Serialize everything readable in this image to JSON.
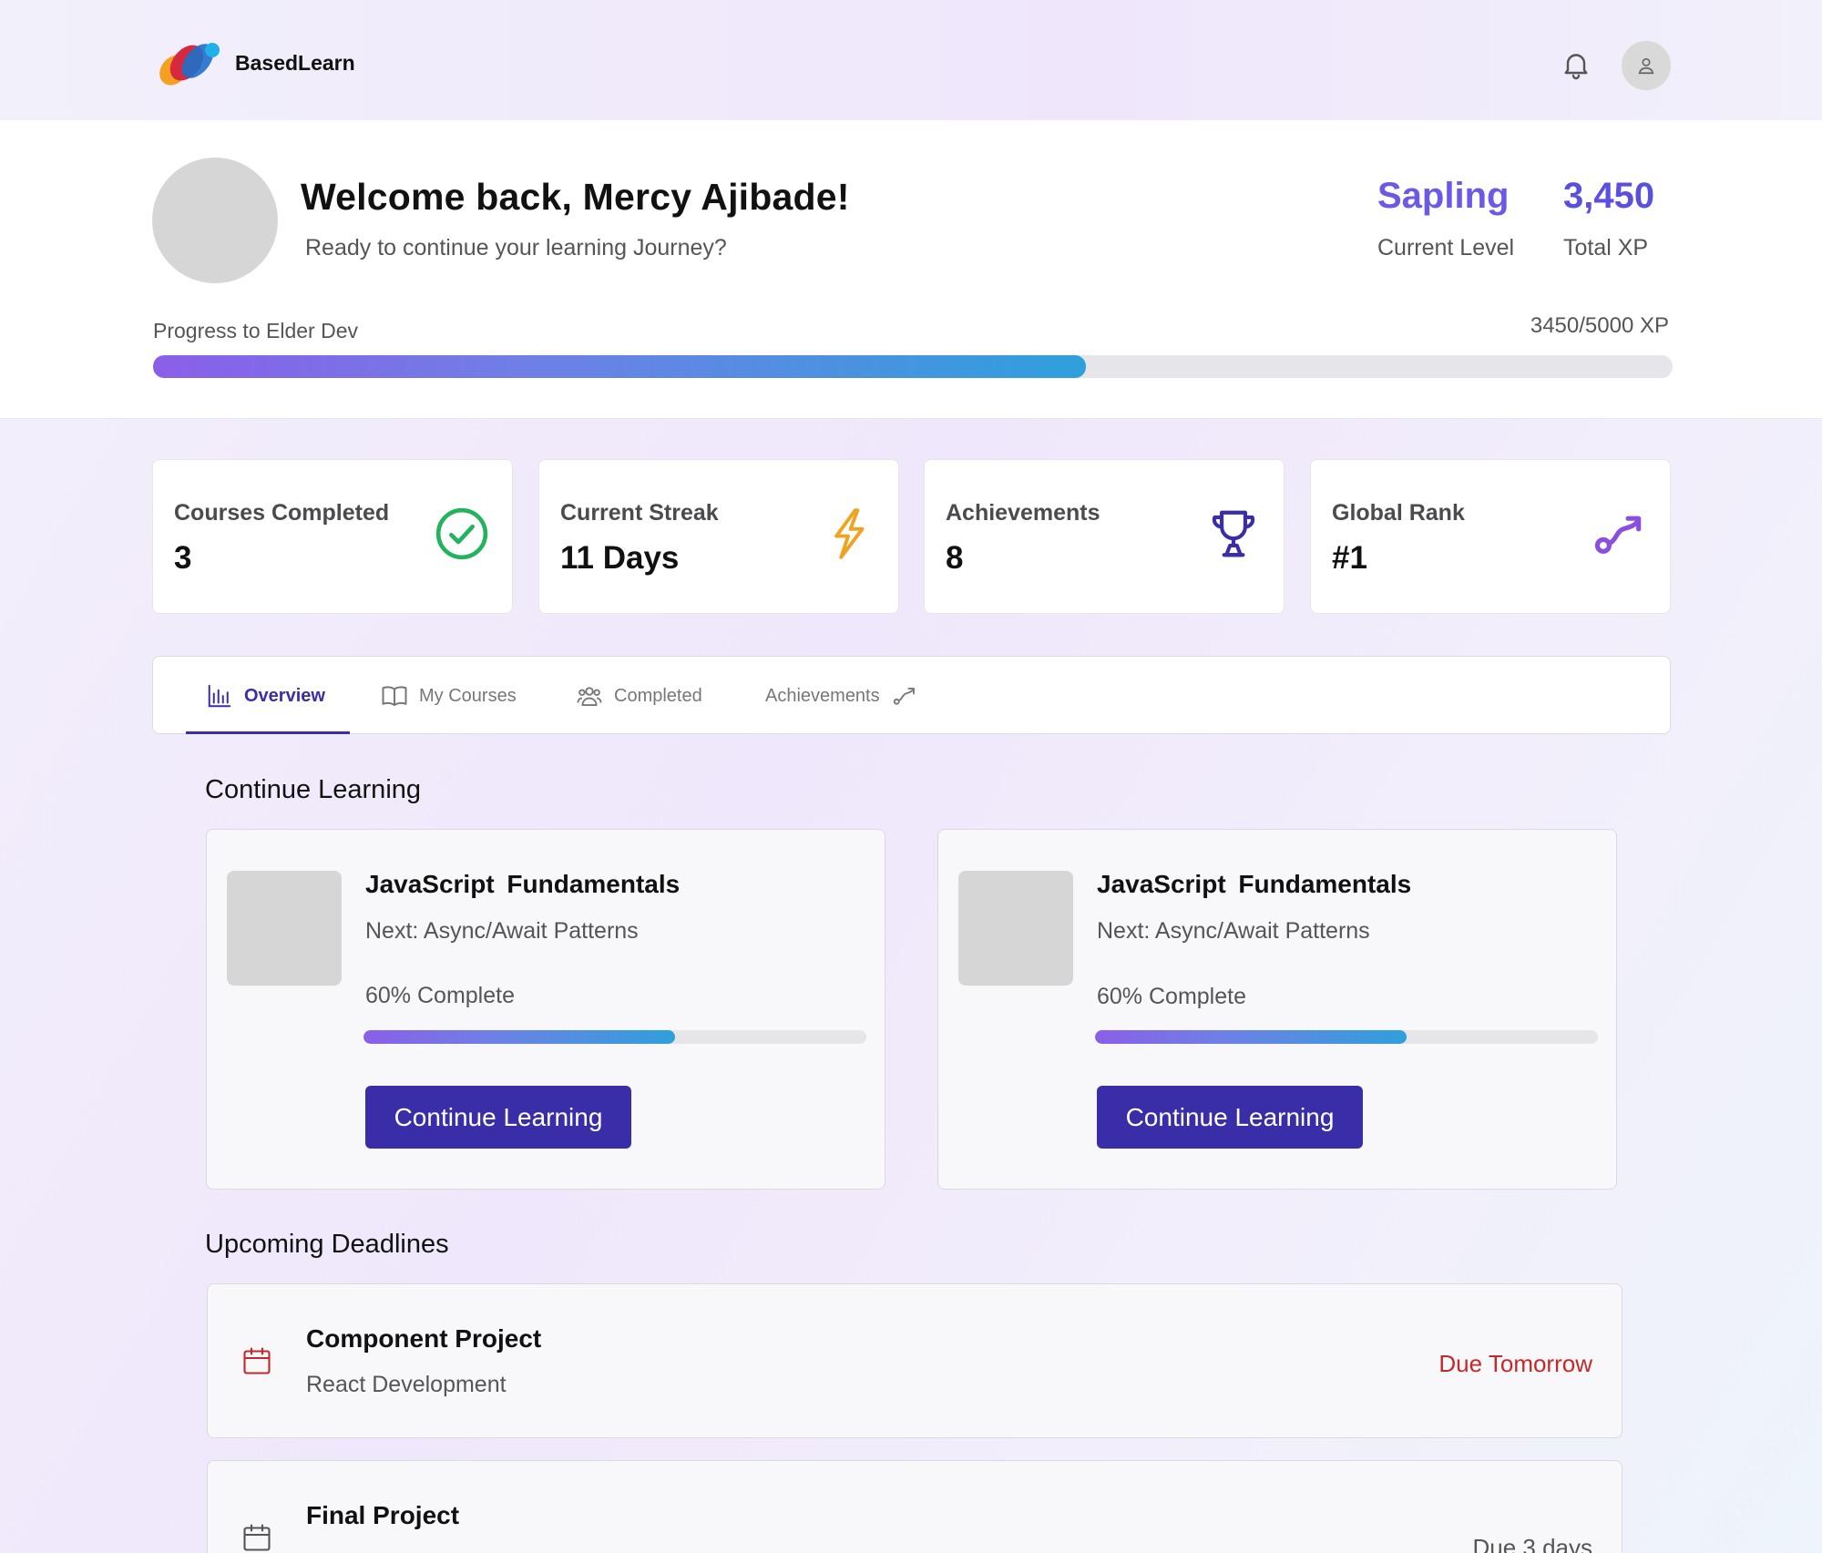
{
  "header": {
    "brand": "BasedLearn",
    "logo_icon": "basedlearn-logo",
    "notification_icon": "bell-icon",
    "profile_icon": "user-icon"
  },
  "welcome": {
    "title": "Welcome back, Mercy Ajibade!",
    "subtitle": "Ready to continue your learning Journey?",
    "level_value": "Sapling",
    "level_label": "Current Level",
    "xp_value": "3,450",
    "xp_label": "Total XP",
    "progress_label": "Progress to Elder Dev",
    "progress_text": "3450/5000 XP",
    "progress_fraction": 0.614
  },
  "stats": [
    {
      "label": "Courses Completed",
      "value": "3",
      "icon": "check-circle-icon",
      "color": "#22b35e"
    },
    {
      "label": "Current Streak",
      "value": "11 Days",
      "icon": "lightning-icon",
      "color": "#f0a321"
    },
    {
      "label": "Achievements",
      "value": "8",
      "icon": "trophy-icon",
      "color": "#3a2ea8"
    },
    {
      "label": "Global Rank",
      "value": "#1",
      "icon": "route-icon",
      "color": "#8a4fe0"
    }
  ],
  "tabs": [
    {
      "label": "Overview",
      "icon": "bar-chart-icon",
      "active": true
    },
    {
      "label": "My Courses",
      "icon": "book-icon",
      "active": false
    },
    {
      "label": "Completed",
      "icon": "users-icon",
      "active": false
    },
    {
      "label": "Achievements",
      "icon": "route-icon",
      "active": false
    }
  ],
  "continue_learning": {
    "title": "Continue Learning",
    "courses": [
      {
        "title": "JavaScript  Fundamentals",
        "next": "Next: Async/Await Patterns",
        "progress_text": "60% Complete",
        "progress_fraction": 0.62,
        "button": "Continue Learning"
      },
      {
        "title": "JavaScript  Fundamentals",
        "next": "Next: Async/Await Patterns",
        "progress_text": "60% Complete",
        "progress_fraction": 0.62,
        "button": "Continue Learning"
      }
    ]
  },
  "deadlines": {
    "title": "Upcoming Deadlines",
    "items": [
      {
        "title": "Component Project",
        "subtitle": "React Development",
        "due": "Due Tomorrow",
        "color": "#c62828"
      },
      {
        "title": "Final Project",
        "subtitle": "",
        "due": "Due 3 days",
        "color": "#555555"
      }
    ]
  }
}
